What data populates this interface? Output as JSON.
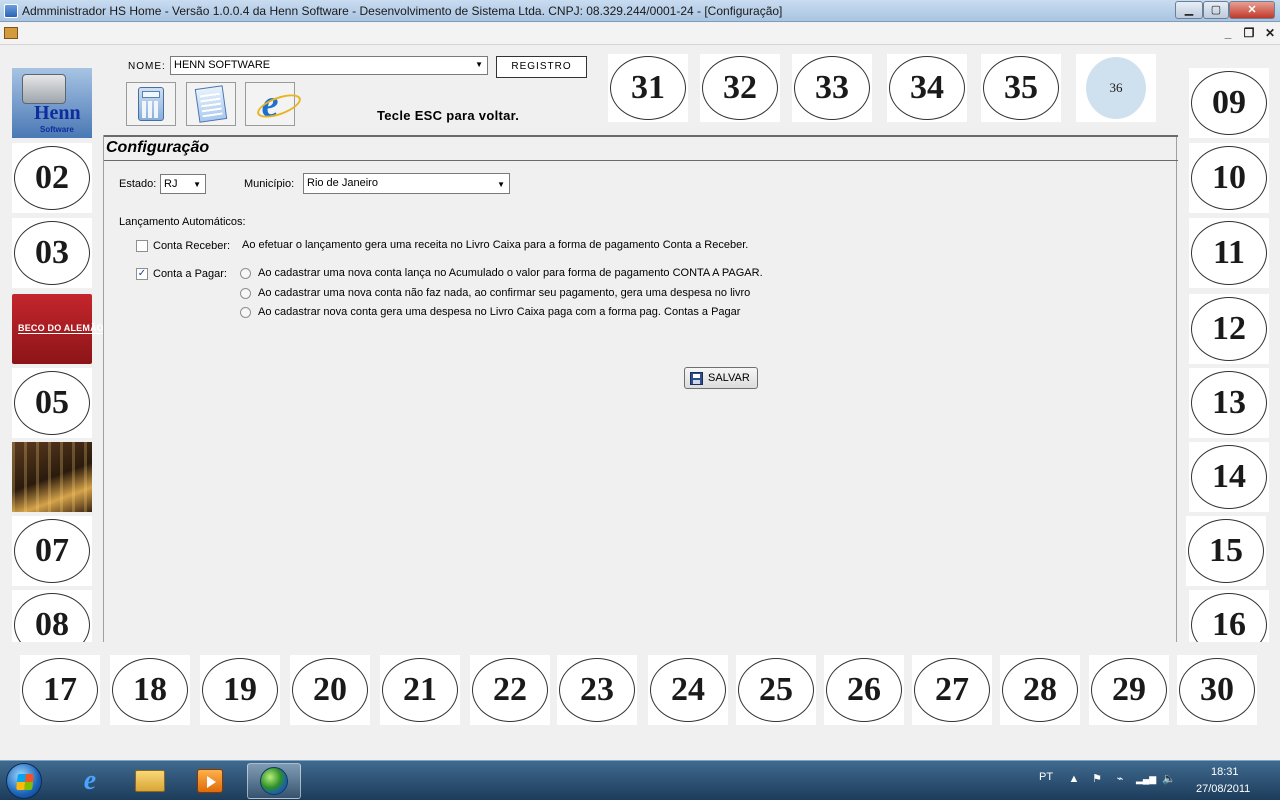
{
  "window": {
    "title": "Admministrador HS Home - Versão 1.0.0.4 da Henn Software - Desenvolvimento de Sistema Ltda. CNPJ: 08.329.244/0001-24 - [Configuração]",
    "minimize_glyph": "▁",
    "maximize_glyph": "▢",
    "close_glyph": "✕"
  },
  "mdi": {
    "minimize_glyph": "_",
    "restore_glyph": "❐",
    "close_glyph": "✕"
  },
  "header": {
    "nome_label": "NOME:",
    "nome_value": "HENN SOFTWARE",
    "registro_label": "REGISTRO",
    "esc_hint": "Tecle ESC para voltar.",
    "apps": [
      {
        "name": "calculator-icon"
      },
      {
        "name": "notepad-icon"
      },
      {
        "name": "internet-explorer-icon",
        "glyph": "e"
      }
    ]
  },
  "left_tiles": {
    "logo_henn": {
      "brand": "Henn",
      "sub": "Software"
    },
    "t02": "02",
    "t03": "03",
    "logo_beco": {
      "text": "BECO DO ALEMÃO"
    },
    "t05": "05",
    "t07": "07",
    "t08": "08"
  },
  "right_tiles": {
    "t09": "09",
    "t10": "10",
    "t11": "11",
    "t12": "12",
    "t13": "13",
    "t14": "14",
    "t15": "15",
    "t16": "16"
  },
  "top_tiles": {
    "t31": "31",
    "t32": "32",
    "t33": "33",
    "t34": "34",
    "t35": "35",
    "t36": "36"
  },
  "bottom_tiles": {
    "t17": "17",
    "t18": "18",
    "t19": "19",
    "t20": "20",
    "t21": "21",
    "t22": "22",
    "t23": "23",
    "t24": "24",
    "t25": "25",
    "t26": "26",
    "t27": "27",
    "t28": "28",
    "t29": "29",
    "t30": "30"
  },
  "config": {
    "title": "Configuração",
    "estado_label": "Estado:",
    "estado_value": "RJ",
    "municipio_label": "Município:",
    "municipio_value": "Rio de Janeiro",
    "lancamento_label": "Lançamento Automáticos:",
    "conta_receber": {
      "label": "Conta Receber:",
      "checked": false,
      "description": "Ao efetuar o lançamento gera uma receita no Livro Caixa para a forma de pagamento Conta a Receber."
    },
    "conta_pagar": {
      "label": "Conta a Pagar:",
      "checked": true,
      "check_glyph": "✓",
      "options": [
        "Ao cadastrar uma nova conta lança no Acumulado o valor para forma de pagamento CONTA A PAGAR.",
        "Ao cadastrar uma nova conta não faz nada, ao confirmar seu pagamento, gera uma despesa no livro",
        "Ao cadastrar nova conta gera uma despesa no Livro Caixa paga com a forma pag. Contas a Pagar"
      ]
    },
    "save_label": "SALVAR"
  },
  "taskbar": {
    "language": "PT",
    "time": "18:31",
    "date": "27/08/2011",
    "up_glyph": "▲",
    "flag_glyph": "⚑",
    "power_glyph": "⌁",
    "signal_glyph": "▂▄▆",
    "volume_glyph": "🔈"
  }
}
